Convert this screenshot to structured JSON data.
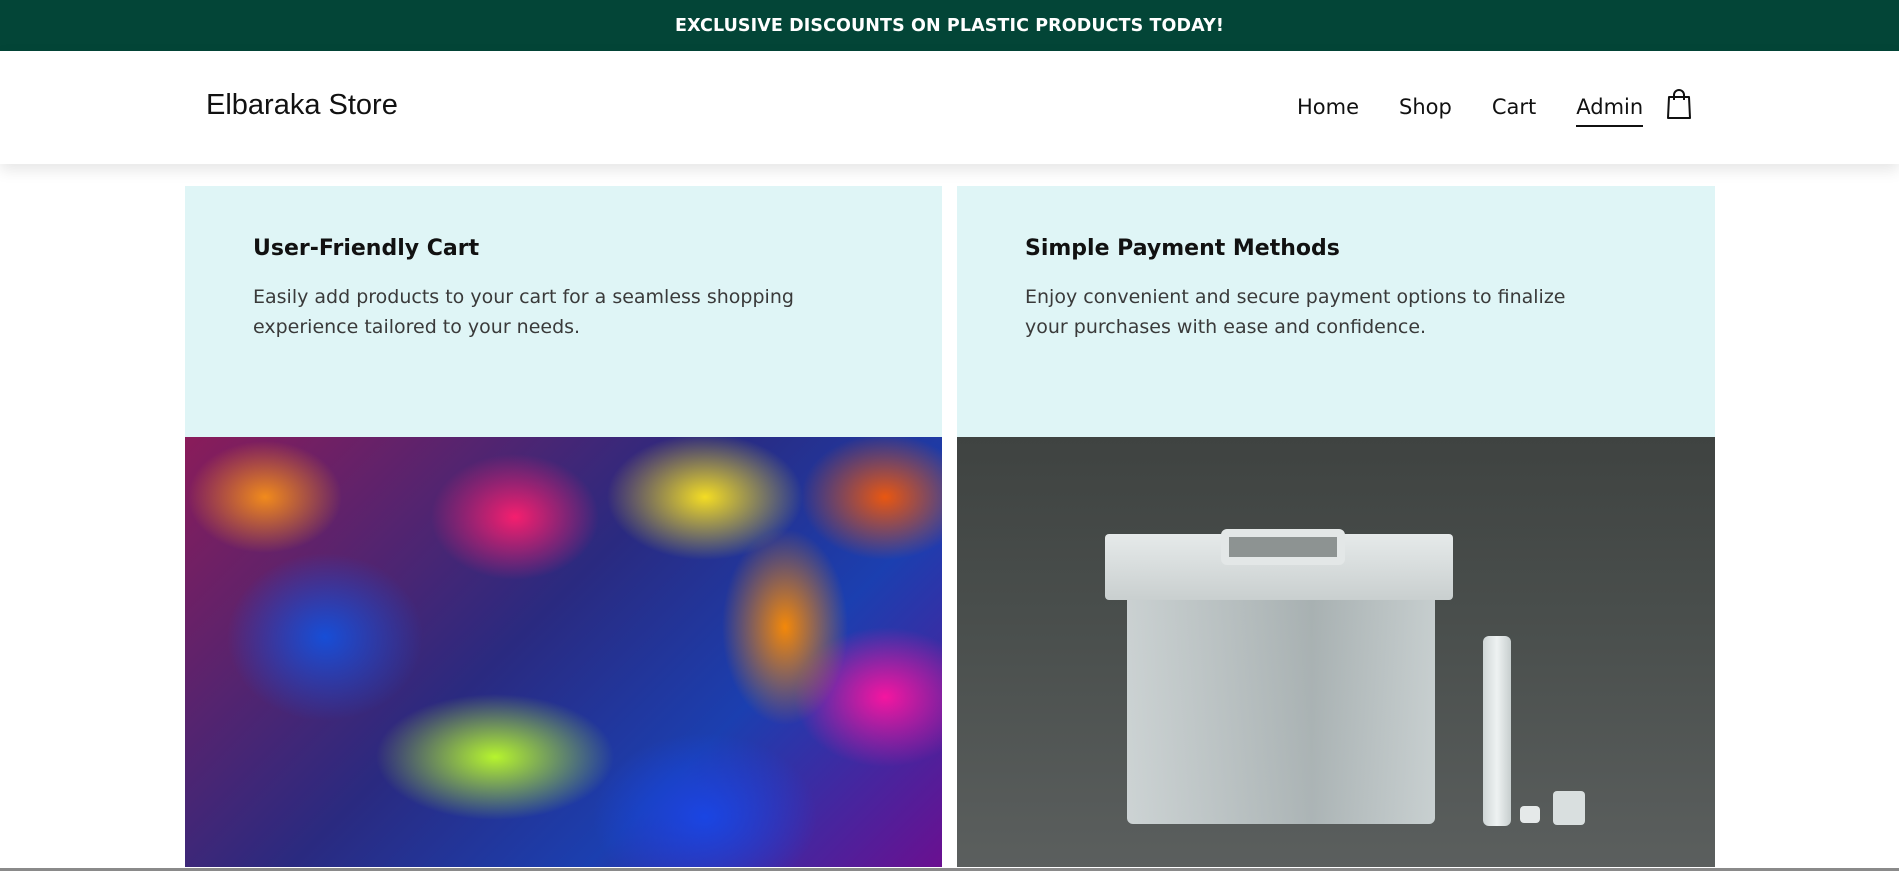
{
  "announcement": {
    "text": "EXCLUSIVE DISCOUNTS ON PLASTIC PRODUCTS TODAY!"
  },
  "header": {
    "brand": "Elbaraka Store",
    "nav": [
      {
        "label": "Home",
        "active": false
      },
      {
        "label": "Shop",
        "active": false
      },
      {
        "label": "Cart",
        "active": false
      },
      {
        "label": "Admin",
        "active": true
      }
    ],
    "cart_icon": "shopping-bag-icon"
  },
  "features": [
    {
      "title": "User-Friendly Cart",
      "description": "Easily add products to your cart for a seamless shopping experience tailored to your needs.",
      "image": "colorful-plastic-toys"
    },
    {
      "title": "Simple Payment Methods",
      "description": "Enjoy convenient and secure payment options to finalize your purchases with ease and confidence.",
      "image": "plastic-container"
    }
  ],
  "colors": {
    "announcement_bg": "#034537",
    "card_bg": "#dff5f6"
  }
}
